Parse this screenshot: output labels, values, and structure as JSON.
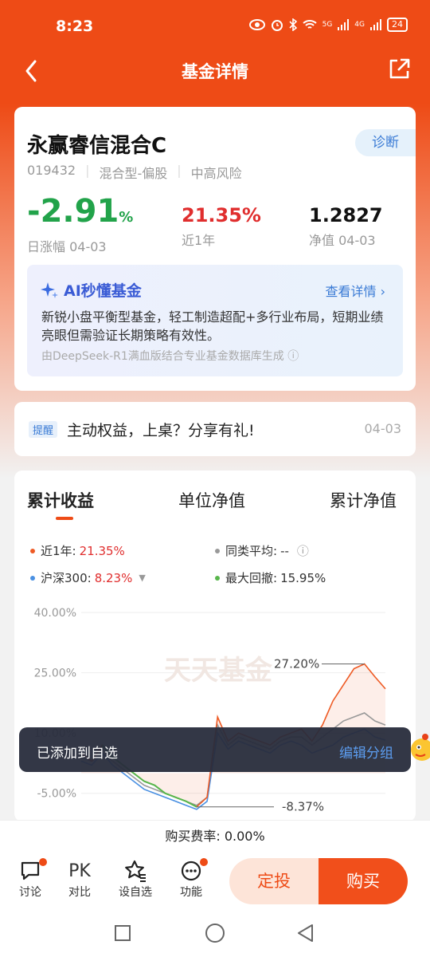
{
  "status": {
    "time": "8:23",
    "battery": "24",
    "net1": "5G",
    "net2": "4G"
  },
  "nav": {
    "title": "基金详情"
  },
  "fund": {
    "name": "永赢睿信混合C",
    "code": "019432",
    "type": "混合型-偏股",
    "risk": "中高风险",
    "diagnose": "诊断",
    "daily_change": "-2.91",
    "daily_unit": "%",
    "daily_label": "日涨幅 04-03",
    "year_return": "21.35%",
    "year_label": "近1年",
    "nav_value": "1.2827",
    "nav_label": "净值 04-03"
  },
  "ai": {
    "title": "AI秒懂基金",
    "more": "查看详情",
    "text": "新锐小盘平衡型基金，轻工制造超配+多行业布局，短期业绩亮眼但需验证长期策略有效性。",
    "footer": "由DeepSeek-R1满血版结合专业基金数据库生成"
  },
  "notice": {
    "tag": "提醒",
    "text": "主动权益，上桌？分享有礼!",
    "date": "04-03"
  },
  "chart_tabs": [
    "累计收益",
    "单位净值",
    "累计净值"
  ],
  "legend": {
    "fund_label": "近1年:",
    "fund_value": "21.35%",
    "avg_label": "同类平均:",
    "avg_value": "--",
    "idx_label": "沪深300:",
    "idx_value": "8.23%",
    "dd_label": "最大回撤:",
    "dd_value": "15.95%"
  },
  "colors": {
    "fund": "#ee5a24",
    "index": "#4a90e2",
    "avg": "#999999",
    "drawdown": "#58b64c",
    "accent": "#ee4b16"
  },
  "chart_data": {
    "type": "line",
    "yticks": [
      "40.00%",
      "25.00%",
      "10.00%",
      "-5.00%"
    ],
    "ylim": [
      -12,
      40
    ],
    "annotations": {
      "max": "27.20%",
      "min": "-8.37%"
    },
    "watermark": "天天基金",
    "series": [
      {
        "name": "近1年",
        "values": [
          5,
          3,
          7,
          4,
          2,
          0,
          -2,
          -3,
          -5,
          -6,
          -7,
          -8.37,
          -6,
          14,
          8,
          10,
          9,
          8,
          7,
          9,
          10,
          11,
          8,
          12,
          18,
          22,
          26,
          27.2,
          24,
          21
        ]
      },
      {
        "name": "沪深300",
        "values": [
          3,
          2,
          5,
          2,
          0,
          -2,
          -4,
          -5,
          -6,
          -7,
          -8,
          -9,
          -7,
          10,
          6,
          8,
          7,
          6,
          5,
          7,
          8,
          7,
          5,
          6,
          7,
          9,
          10,
          11,
          9,
          8.23
        ]
      },
      {
        "name": "同类平均",
        "values": [
          4,
          3,
          5,
          3,
          1,
          -1,
          -3,
          -4,
          -5,
          -6,
          -7,
          -8,
          -6,
          12,
          7,
          9,
          8,
          7,
          6,
          8,
          9,
          9,
          7,
          9,
          11,
          13,
          14,
          15,
          13,
          12
        ]
      }
    ]
  },
  "toast": {
    "message": "已添加到自选",
    "action": "编辑分组"
  },
  "fee": "购买费率: 0.00%",
  "bottom": {
    "discuss": "讨论",
    "compare": "对比",
    "compare_icon": "PK",
    "watchlist": "设自选",
    "functions": "功能",
    "sip": "定投",
    "buy": "购买"
  }
}
